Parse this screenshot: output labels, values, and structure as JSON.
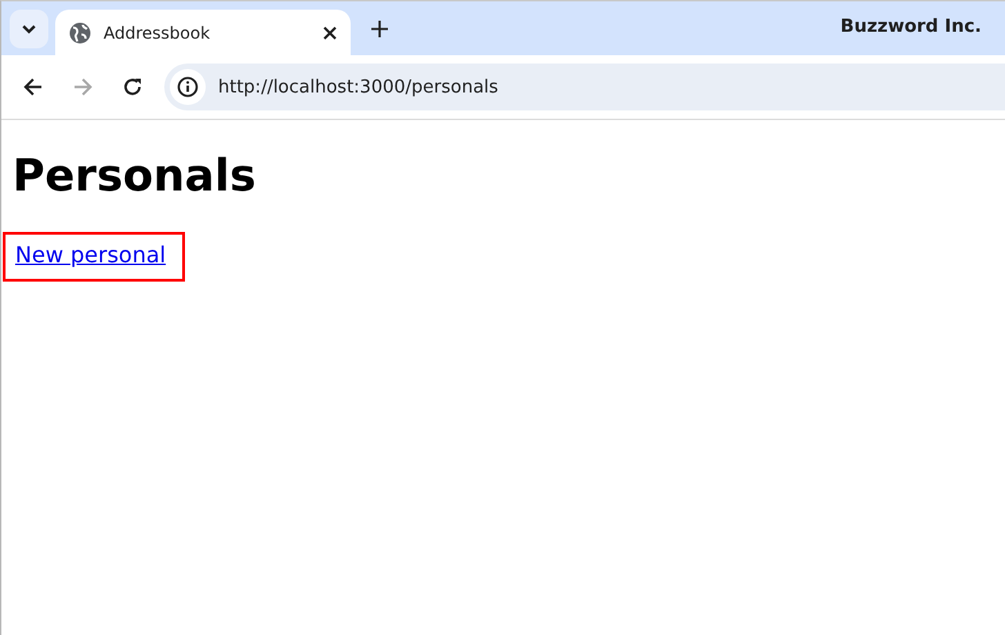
{
  "browser": {
    "tab": {
      "title": "Addressbook",
      "selected": true
    },
    "profile": "Buzzword Inc.",
    "url": "http://localhost:3000/personals",
    "forward_disabled": true
  },
  "page": {
    "heading": "Personals",
    "link": {
      "label": "New personal",
      "highlighted": true
    }
  }
}
